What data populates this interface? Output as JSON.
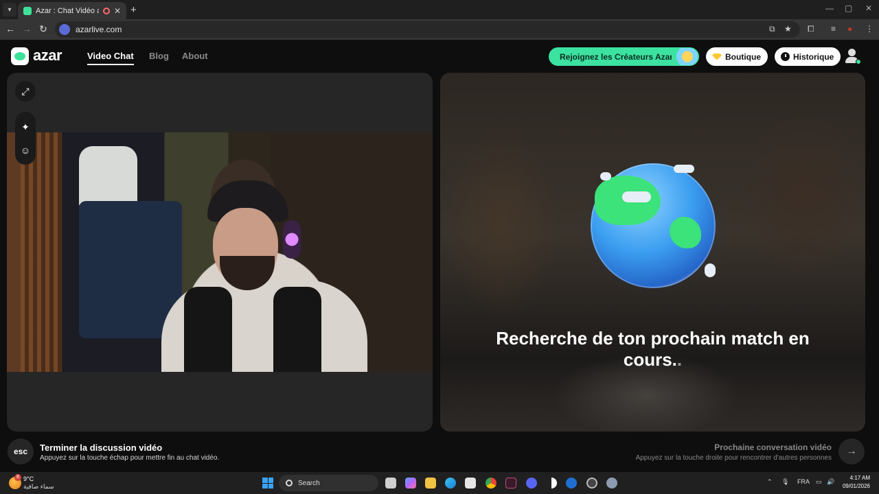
{
  "browser": {
    "tab_title": "Azar : Chat Vidéo avec de n",
    "url": "azarlive.com"
  },
  "header": {
    "logo_text": "azar",
    "nav": [
      {
        "label": "Video Chat",
        "active": true
      },
      {
        "label": "Blog",
        "active": false
      },
      {
        "label": "About",
        "active": false
      }
    ],
    "creators_label": "Rejoignez les Créateurs Azar",
    "shop_label": "Boutique",
    "history_label": "Historique"
  },
  "match": {
    "status_line1": "Recherche de ton prochain match en",
    "status_line2": "cours.",
    "status_dots": "."
  },
  "bottom": {
    "esc_key": "esc",
    "end_title": "Terminer la discussion vidéo",
    "end_sub": "Appuyez sur la touche échap pour mettre fin au chat vidéo.",
    "next_title": "Prochaine conversation vidéo",
    "next_sub": "Appuyez sur la touche droite pour rencontrer d'autres personnes",
    "next_arrow": "→"
  },
  "taskbar": {
    "weather_badge": "8",
    "temperature": "9°C",
    "condition": "سماء صافية",
    "search_label": "Search",
    "language": "FRA",
    "time": "4:17 AM",
    "date": "09/01/2026"
  },
  "colors": {
    "accent": "#3ce2a0",
    "background": "#0e0e0e",
    "panel": "#262626"
  }
}
